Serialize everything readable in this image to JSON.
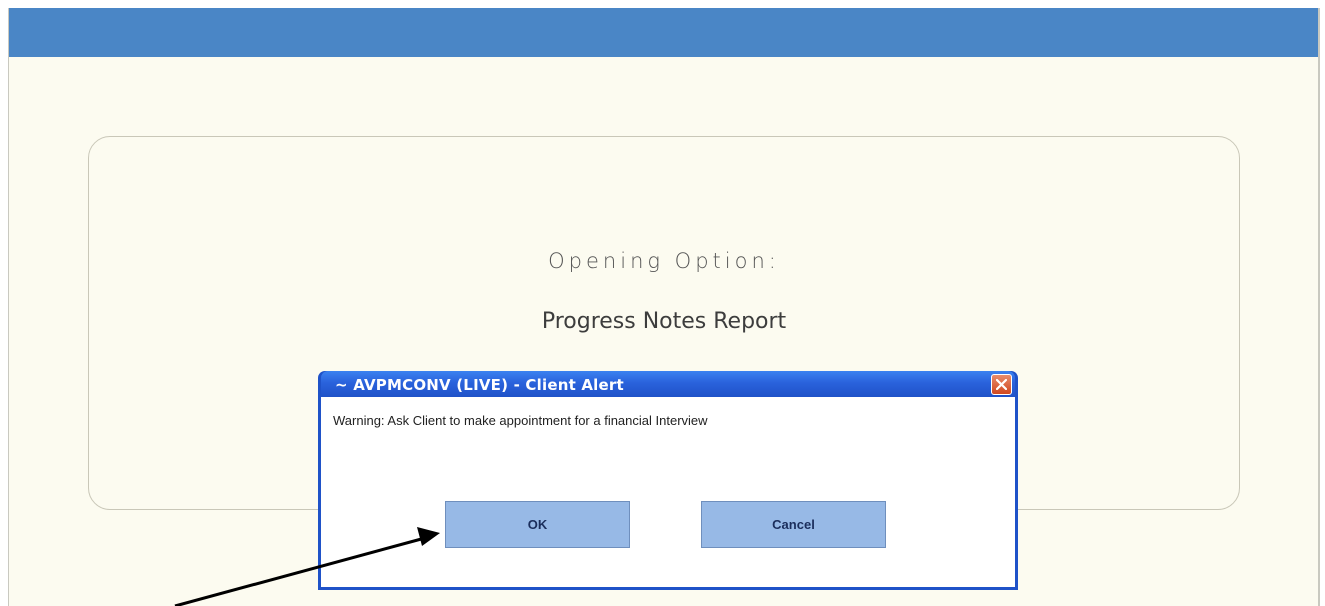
{
  "panel": {
    "heading": "Opening Option:",
    "value": "Progress Notes Report"
  },
  "dialog": {
    "title": "~ AVPMCONV (LIVE) - Client Alert",
    "message": "Warning: Ask Client to make appointment for a financial Interview",
    "ok_label": "OK",
    "cancel_label": "Cancel",
    "close_icon": "close-icon"
  },
  "colors": {
    "top_bar": "#4a86c6",
    "background": "#fcfbf0",
    "dialog_frame": "#1f52c8",
    "button": "#97b9e6",
    "close_button": "#d1481f"
  }
}
